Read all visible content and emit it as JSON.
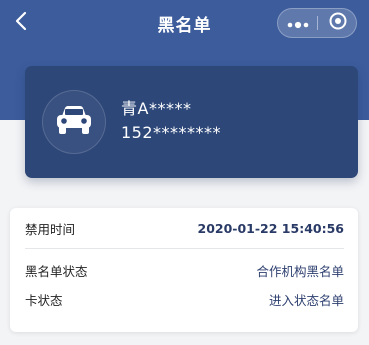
{
  "nav": {
    "title": "黑名单",
    "back_icon": "chevron-left-icon",
    "more_icon": "more-dots-icon",
    "close_icon": "target-close-icon"
  },
  "card": {
    "icon": "car-icon",
    "plate": "青A*****",
    "phone": "152********"
  },
  "info": {
    "rows": [
      {
        "label": "禁用时间",
        "value": "2020-01-22 15:40:56"
      },
      {
        "label": "黑名单状态",
        "value": "合作机构黑名单"
      },
      {
        "label": "卡状态",
        "value": "进入状态名单"
      }
    ]
  },
  "colors": {
    "header": "#3c5c9c",
    "card": "#2d4779",
    "background": "#f3f4f6",
    "accent_text": "#2a3a66"
  }
}
